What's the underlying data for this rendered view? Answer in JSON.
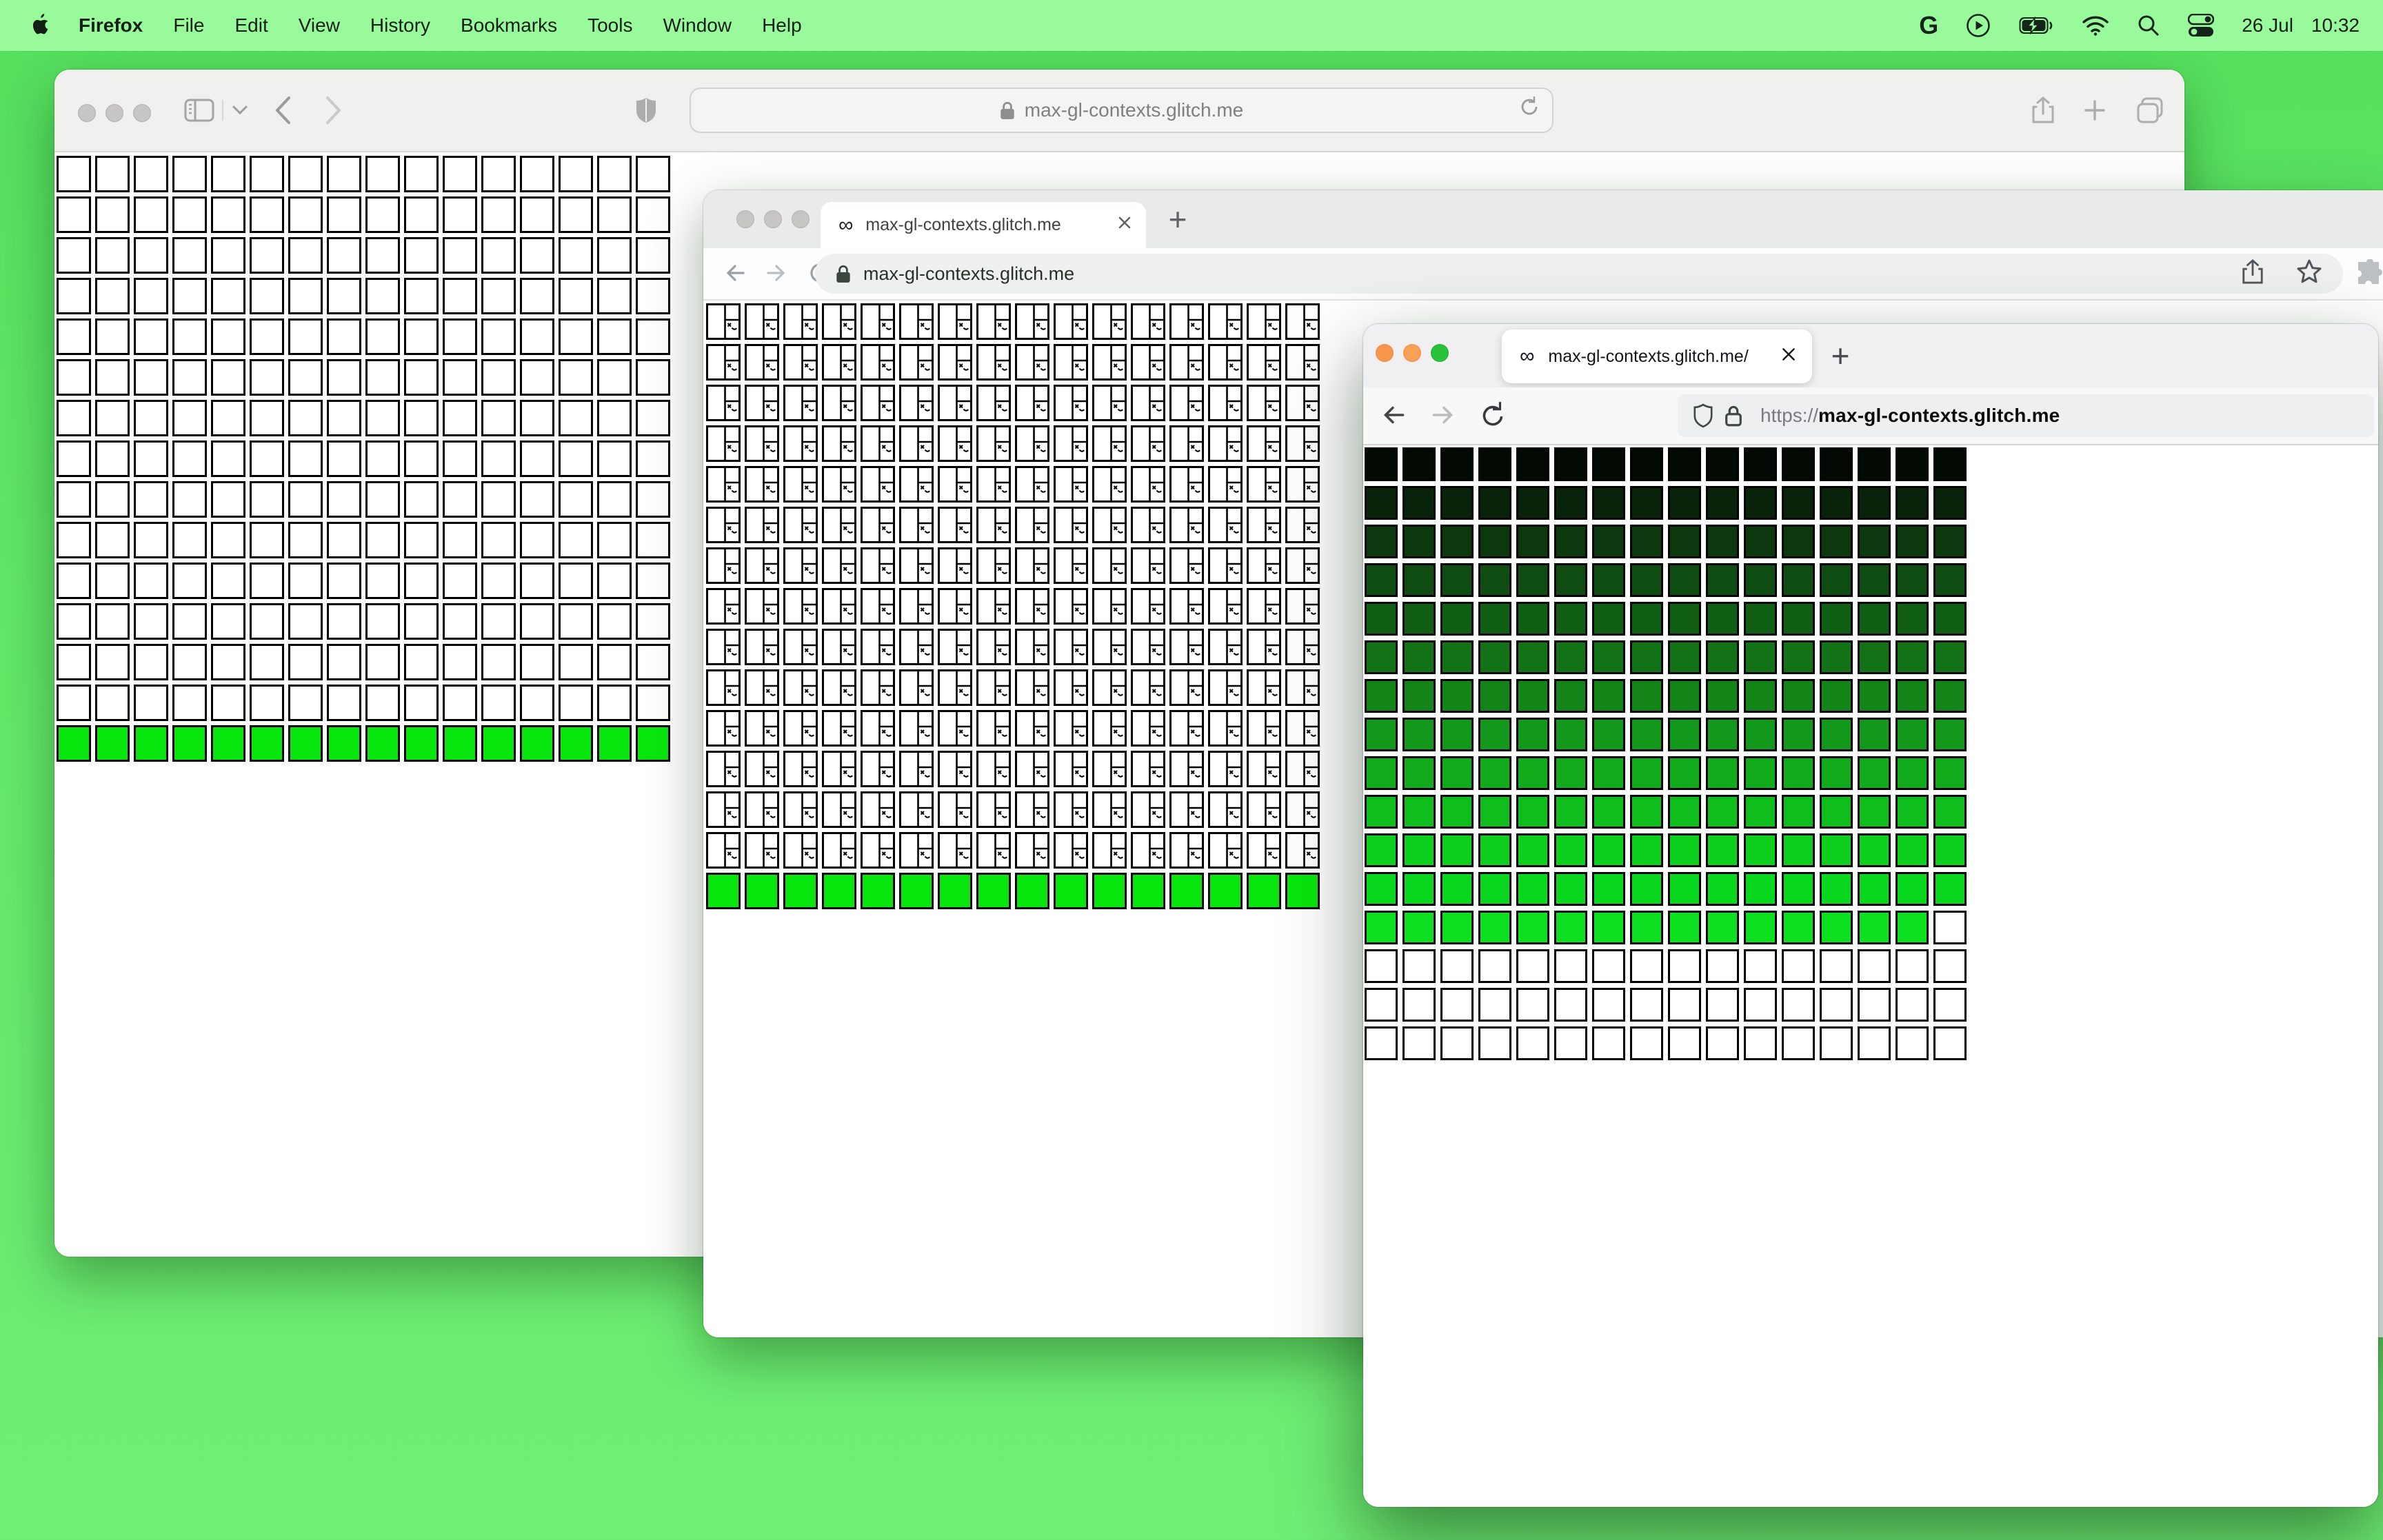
{
  "menu_bar": {
    "app_name": "Firefox",
    "menus": [
      "File",
      "Edit",
      "View",
      "History",
      "Bookmarks",
      "Tools",
      "Window",
      "Help"
    ],
    "status_icons": [
      "google-g-icon",
      "play-circle-icon",
      "battery-charging-icon",
      "wifi-icon",
      "spotlight-search-icon",
      "control-center-icon"
    ],
    "date": "26 Jul",
    "time": "10:32"
  },
  "site": {
    "favicon_glyph": "∞",
    "green_row_color": "#08e70d"
  },
  "safari": {
    "url_text": "max-gl-contexts.glitch.me",
    "grid": {
      "cols": 16,
      "rows": [
        {
          "repeat": 14,
          "fill": "#ffffff"
        },
        {
          "fill": "#08e70d"
        }
      ]
    }
  },
  "chrome": {
    "tab_title": "max-gl-contexts.glitch.me",
    "close_label": "X",
    "url_text": "max-gl-contexts.glitch.me",
    "grid": {
      "cols": 16,
      "rows": [
        {
          "repeat": 14,
          "type": "broken"
        },
        {
          "fill": "#08e70d"
        }
      ]
    }
  },
  "firefox": {
    "tab_title": "max-gl-contexts.glitch.me/",
    "close_label": "X",
    "url_scheme": "https://",
    "url_domain": "max-gl-contexts.glitch.me",
    "traffic_colors": [
      "#f7974e",
      "#f8a055",
      "#2bc13a"
    ],
    "grid": {
      "cols": 16,
      "rows": [
        {
          "fill": "#030a03"
        },
        {
          "fill": "#082309"
        },
        {
          "fill": "#0c380d"
        },
        {
          "fill": "#0f4c11"
        },
        {
          "fill": "#115f14"
        },
        {
          "fill": "#127216"
        },
        {
          "fill": "#138518"
        },
        {
          "fill": "#12981a"
        },
        {
          "fill": "#11ab1b"
        },
        {
          "fill": "#0fbd1c"
        },
        {
          "fill": "#0ccf1e"
        },
        {
          "fill": "#09d81f"
        },
        {
          "fill": "#0ce020",
          "last_cell_fill": "#ffffff"
        },
        {
          "repeat": 3,
          "fill": "#ffffff"
        }
      ]
    }
  }
}
